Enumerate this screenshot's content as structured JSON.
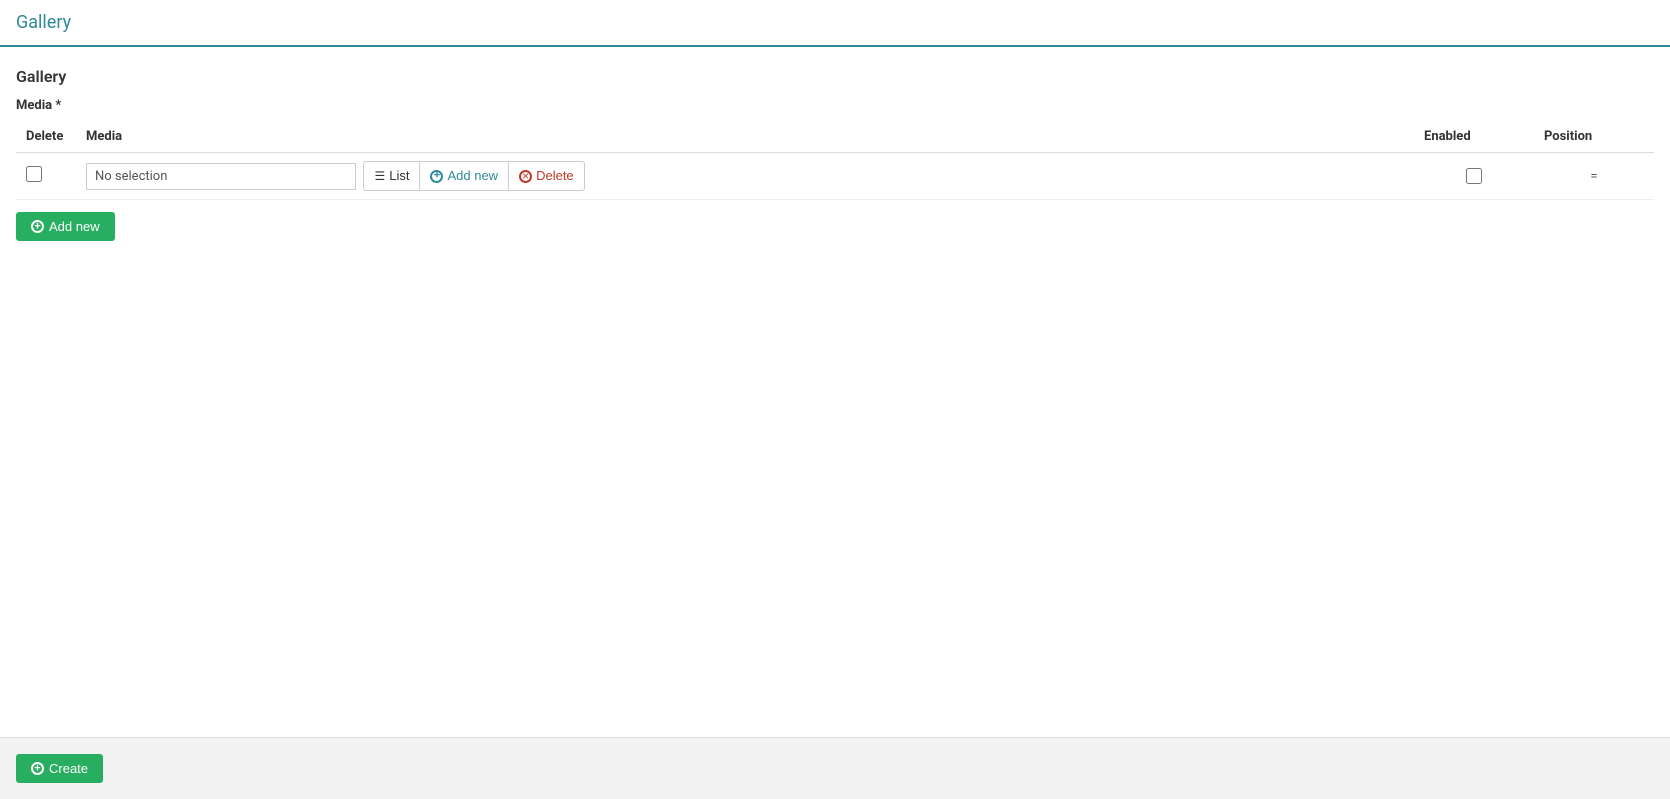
{
  "page": {
    "title": "Gallery"
  },
  "section": {
    "title": "Gallery"
  },
  "media_field": {
    "label": "Media",
    "required": true
  },
  "table": {
    "columns": {
      "delete": "Delete",
      "media": "Media",
      "enabled": "Enabled",
      "position": "Position"
    },
    "rows": [
      {
        "no_selection_text": "No selection",
        "position_text": "=",
        "enabled": false,
        "delete": false
      }
    ]
  },
  "buttons": {
    "list_label": "List",
    "add_new_label": "Add new",
    "delete_label": "Delete",
    "add_new_row_label": "Add new",
    "create_label": "Create"
  }
}
